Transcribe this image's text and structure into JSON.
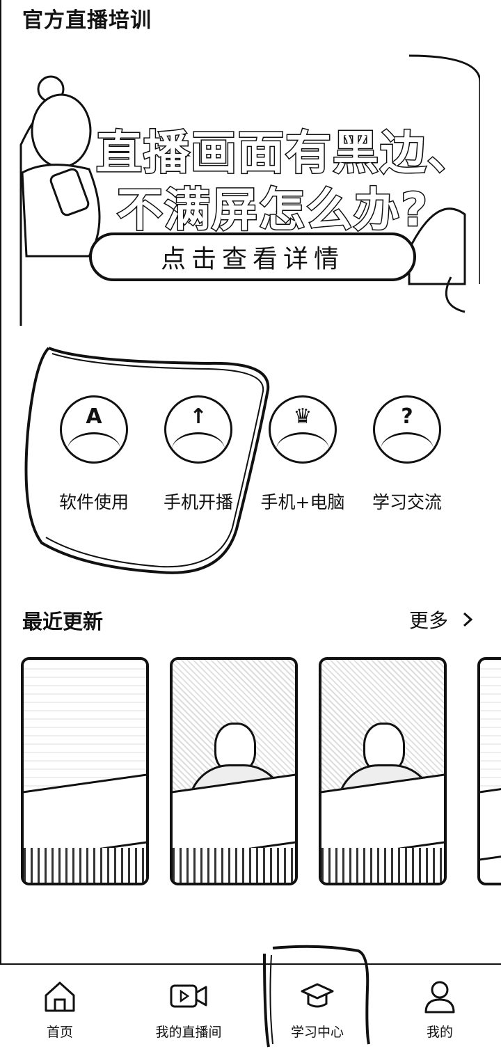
{
  "header": {
    "title": "官方直播培训"
  },
  "banner": {
    "line1": "直播画面有黑边、",
    "line2": "不满屏怎么办?",
    "cta": "点击查看详情"
  },
  "categories": [
    {
      "label": "软件使用",
      "glyph": "A",
      "icon": "letter-a-icon"
    },
    {
      "label": "手机开播",
      "glyph": "↑",
      "icon": "upload-arrow-icon"
    },
    {
      "label": "手机+电脑",
      "glyph": "♛",
      "icon": "crown-icon"
    },
    {
      "label": "学习交流",
      "glyph": "?",
      "icon": "question-icon"
    }
  ],
  "recent": {
    "title": "最近更新",
    "more": "更多"
  },
  "tabs": [
    {
      "label": "首页",
      "icon": "home-icon"
    },
    {
      "label": "我的直播间",
      "icon": "video-camera-icon"
    },
    {
      "label": "学习中心",
      "icon": "graduation-cap-icon"
    },
    {
      "label": "我的",
      "icon": "user-icon"
    }
  ]
}
